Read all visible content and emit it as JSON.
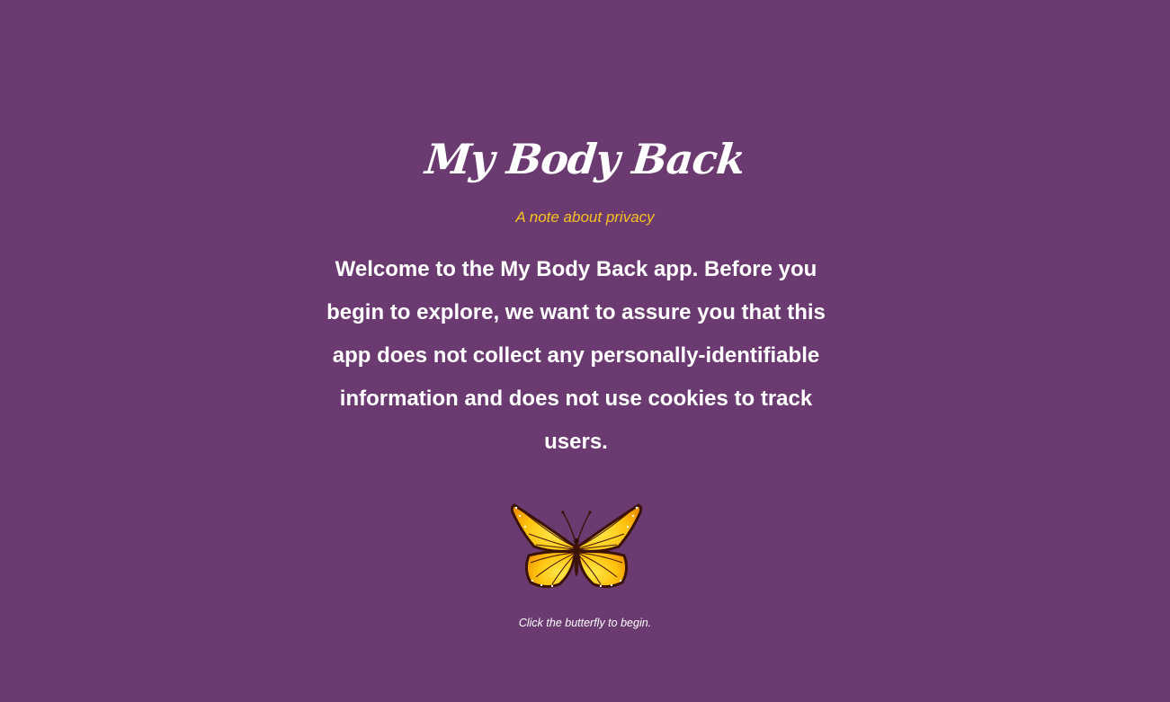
{
  "app": {
    "title": "My Body Back",
    "subtitle": "A note about privacy",
    "privacy_message": "Welcome to the My Body Back app. Before you begin to explore, we want to assure you that this app does not collect any personally-identifiable information and does not use cookies to track users.",
    "hint": "Click the butterfly to begin.",
    "start_icon": "butterfly-icon"
  },
  "colors": {
    "background": "#6b3a71",
    "accent": "#f6c21f",
    "text": "#ffffff",
    "butterfly_wing": "#ffd21a",
    "butterfly_edge": "#3a1208"
  }
}
